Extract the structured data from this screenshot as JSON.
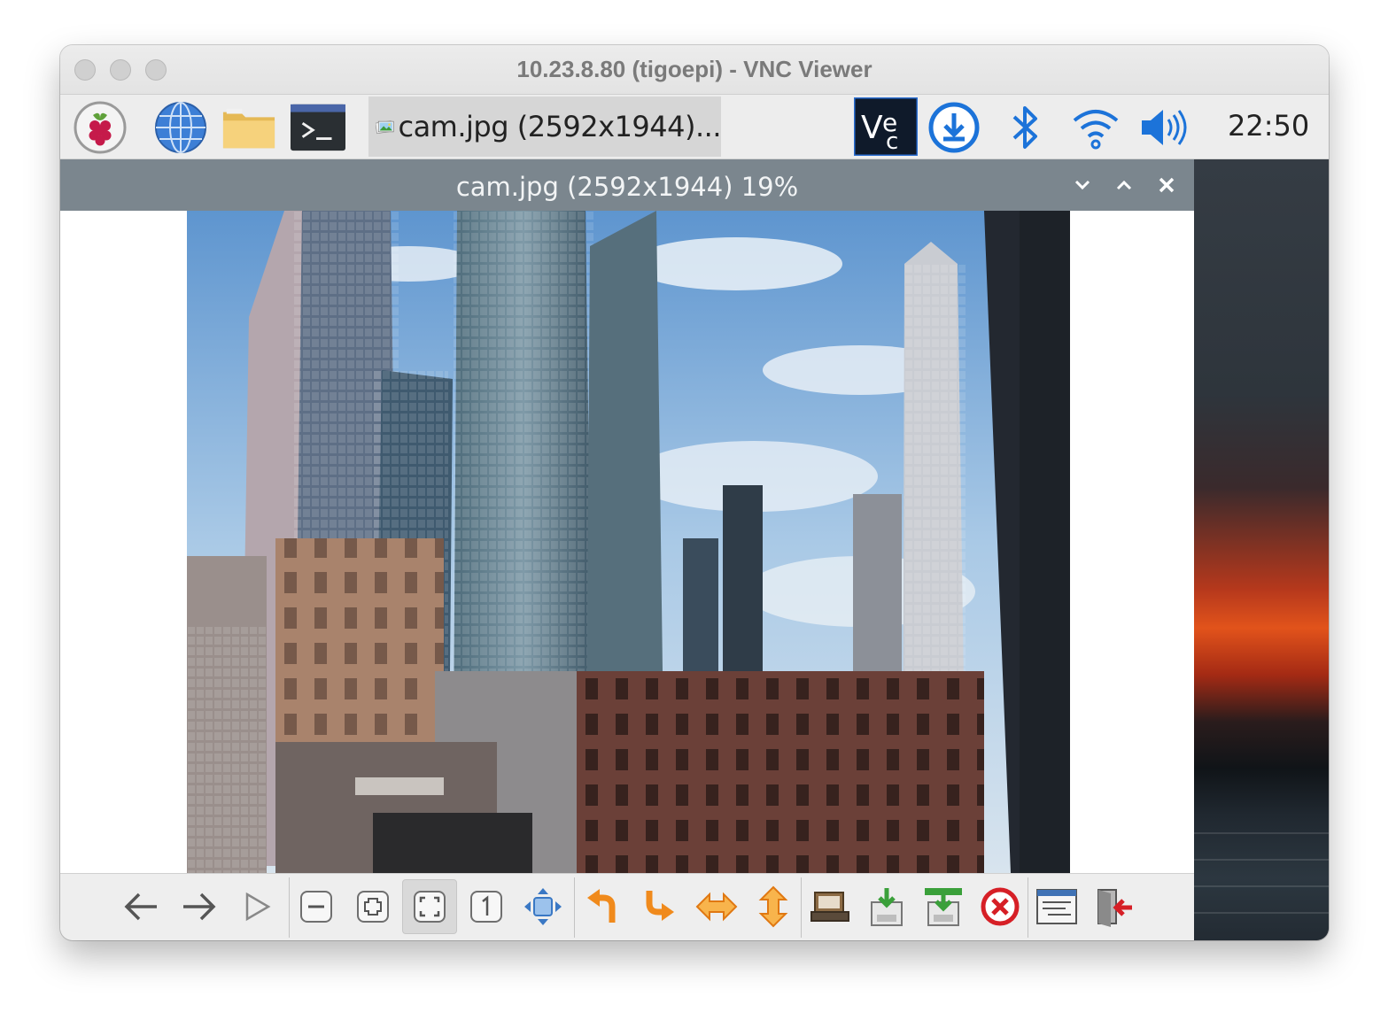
{
  "window": {
    "title": "10.23.8.80 (tigoepi) - VNC Viewer"
  },
  "taskbar": {
    "launchers": [
      {
        "name": "raspberry-menu",
        "icon": "raspberry-icon"
      },
      {
        "name": "web-browser",
        "icon": "globe-icon"
      },
      {
        "name": "file-manager",
        "icon": "folder-icon"
      },
      {
        "name": "terminal",
        "icon": "terminal-icon"
      }
    ],
    "task": {
      "label": "cam.jpg (2592x1944)...",
      "icon": "image-icon"
    },
    "tray": [
      "vnc-icon",
      "download-icon",
      "bluetooth-icon",
      "wifi-icon",
      "volume-icon"
    ],
    "clock": "22:50"
  },
  "viewer": {
    "title": "cam.jpg (2592x1944) 19%",
    "controls": [
      "minimize",
      "maximize",
      "close"
    ],
    "toolbar": [
      {
        "name": "previous",
        "icon": "arrow-left-icon"
      },
      {
        "name": "next",
        "icon": "arrow-right-icon"
      },
      {
        "name": "slideshow",
        "icon": "play-icon"
      },
      {
        "name": "zoom-out",
        "icon": "zoom-out-icon"
      },
      {
        "name": "zoom-in",
        "icon": "zoom-in-icon"
      },
      {
        "name": "fit-to-window",
        "icon": "fit-icon",
        "active": true
      },
      {
        "name": "original-size",
        "icon": "one-to-one-icon"
      },
      {
        "name": "full-screen",
        "icon": "move-icon"
      },
      {
        "name": "rotate-left",
        "icon": "rotate-left-icon"
      },
      {
        "name": "rotate-right",
        "icon": "rotate-right-icon"
      },
      {
        "name": "flip-horizontal",
        "icon": "flip-horizontal-icon"
      },
      {
        "name": "flip-vertical",
        "icon": "flip-vertical-icon"
      },
      {
        "name": "open-file",
        "icon": "open-icon"
      },
      {
        "name": "save-file",
        "icon": "save-icon"
      },
      {
        "name": "save-as",
        "icon": "save-as-icon"
      },
      {
        "name": "delete-file",
        "icon": "delete-icon"
      },
      {
        "name": "preferences",
        "icon": "preferences-icon"
      },
      {
        "name": "quit",
        "icon": "exit-icon"
      }
    ]
  },
  "colors": {
    "viewer_header": "#7b868e",
    "taskbar": "#ededed",
    "accent_blue": "#1c73d9",
    "toolbar_orange": "#f08a1c"
  }
}
